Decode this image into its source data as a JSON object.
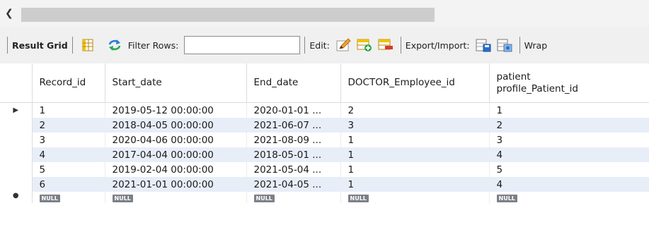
{
  "toolbar": {
    "result_grid": "Result Grid",
    "filter_rows": "Filter Rows:",
    "filter_value": "",
    "edit": "Edit:",
    "export_import": "Export/Import:",
    "wrap": "Wrap"
  },
  "columns": [
    "Record_id",
    "Start_date",
    "End_date",
    "DOCTOR_Employee_id",
    "patient",
    "profile_Patient_id"
  ],
  "rows": [
    {
      "record_id": "1",
      "start_date": "2019-05-12 00:00:00",
      "end_date": "2020-01-01 ...",
      "doctor_id": "2",
      "patient_id": "1"
    },
    {
      "record_id": "2",
      "start_date": "2018-04-05 00:00:00",
      "end_date": "2021-06-07 ...",
      "doctor_id": "3",
      "patient_id": "2"
    },
    {
      "record_id": "3",
      "start_date": "2020-04-06 00:00:00",
      "end_date": "2021-08-09 ...",
      "doctor_id": "1",
      "patient_id": "3"
    },
    {
      "record_id": "4",
      "start_date": "2017-04-04 00:00:00",
      "end_date": "2018-05-01 ...",
      "doctor_id": "1",
      "patient_id": "4"
    },
    {
      "record_id": "5",
      "start_date": "2019-02-04 00:00:00",
      "end_date": "2021-05-04 ...",
      "doctor_id": "1",
      "patient_id": "5"
    },
    {
      "record_id": "6",
      "start_date": "2021-01-01 00:00:00",
      "end_date": "2021-04-05 ...",
      "doctor_id": "1",
      "patient_id": "4"
    }
  ],
  "null_label": "NULL",
  "colors": {
    "alt_row": "#e8eef8",
    "null_badge": "#7c8087"
  }
}
